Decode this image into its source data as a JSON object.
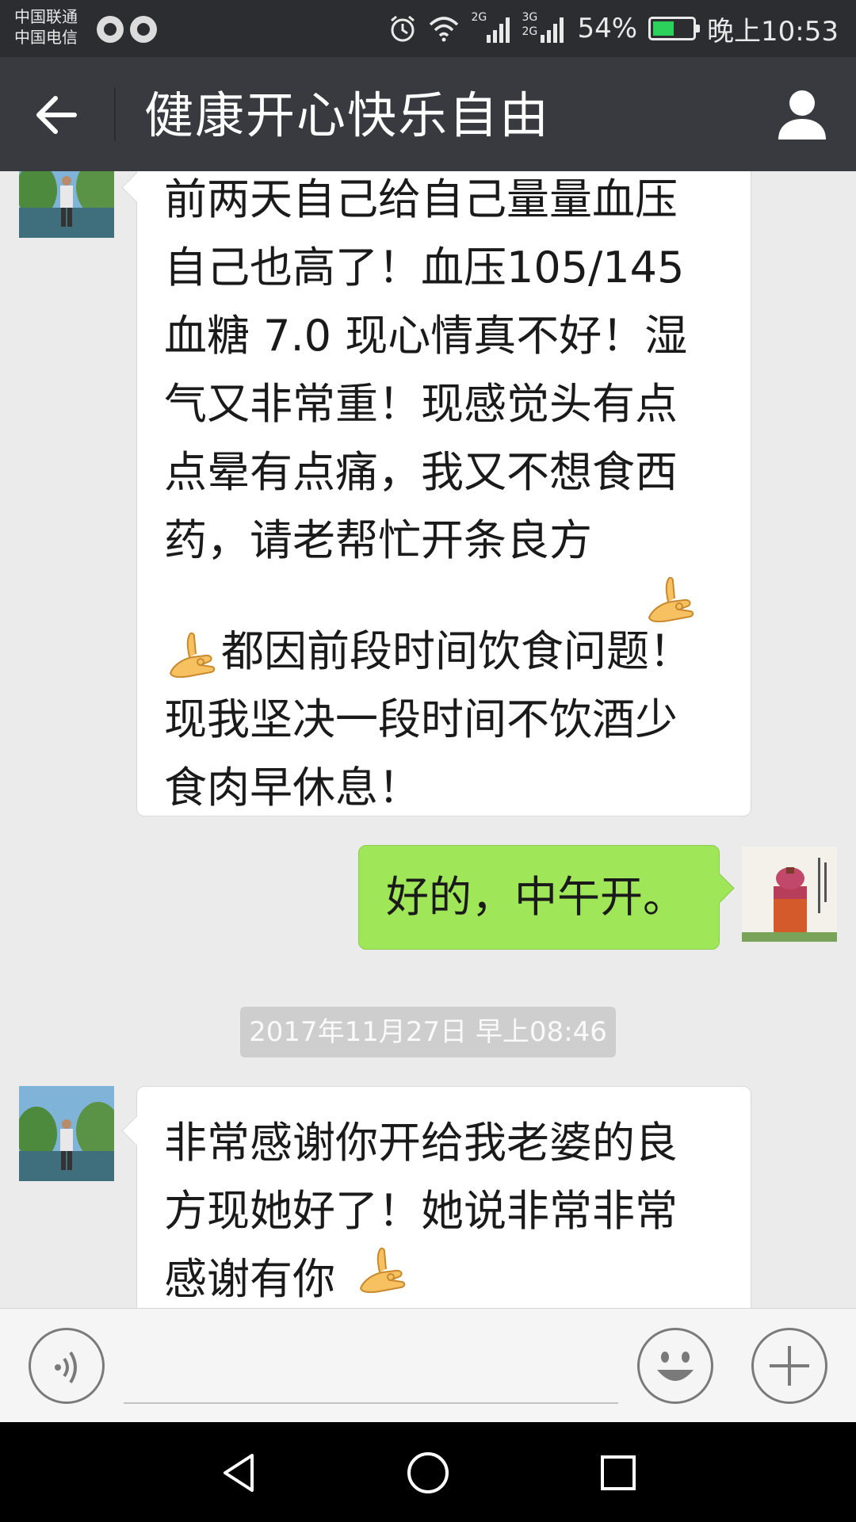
{
  "status_bar": {
    "carrier_1": "中国联通",
    "carrier_2": "中国电信",
    "signal_1_label": "2G",
    "signal_2_label_top": "3G",
    "signal_2_label_bottom": "2G",
    "battery_percent": "54%",
    "battery_level": 0.54,
    "time": "晚上10:53",
    "icons": [
      "qq-icon",
      "qq-penguin-icon",
      "alarm-icon",
      "wifi-icon",
      "signal-icon",
      "battery-icon"
    ]
  },
  "nav": {
    "title": "健康开心快乐自由",
    "back_icon": "arrow-left-icon",
    "profile_icon": "person-icon"
  },
  "messages": [
    {
      "side": "left",
      "text_before_emoji": "前两天自己给自己量量血压\n自己也高了！血压105/145\n血糖 7.0 现心情真不好！湿\n气又非常重！现感觉头有点\n点晕有点痛，我又不想食西\n药，请老帮忙开条良方",
      "text_after_emoji": "都因前段时间饮食问题！\n现我坚决一段时间不饮酒少\n食肉早休息！",
      "emoji": "ok-hand-emoji"
    },
    {
      "side": "right",
      "text": "好的，中午开。"
    }
  ],
  "timestamp": "2017年11月27日 早上08:46",
  "messages_after": [
    {
      "side": "left",
      "text": "非常感谢你开给我老婆的良\n方现她好了！她说非常非常\n感谢有你",
      "emoji": "ok-hand-emoji"
    }
  ],
  "input_bar": {
    "voice_icon": "voice-icon",
    "emoji_icon": "smiley-icon",
    "more_icon": "plus-icon",
    "text_value": ""
  },
  "system_nav": {
    "icons": [
      "back-triangle-icon",
      "home-circle-icon",
      "recents-square-icon"
    ]
  }
}
